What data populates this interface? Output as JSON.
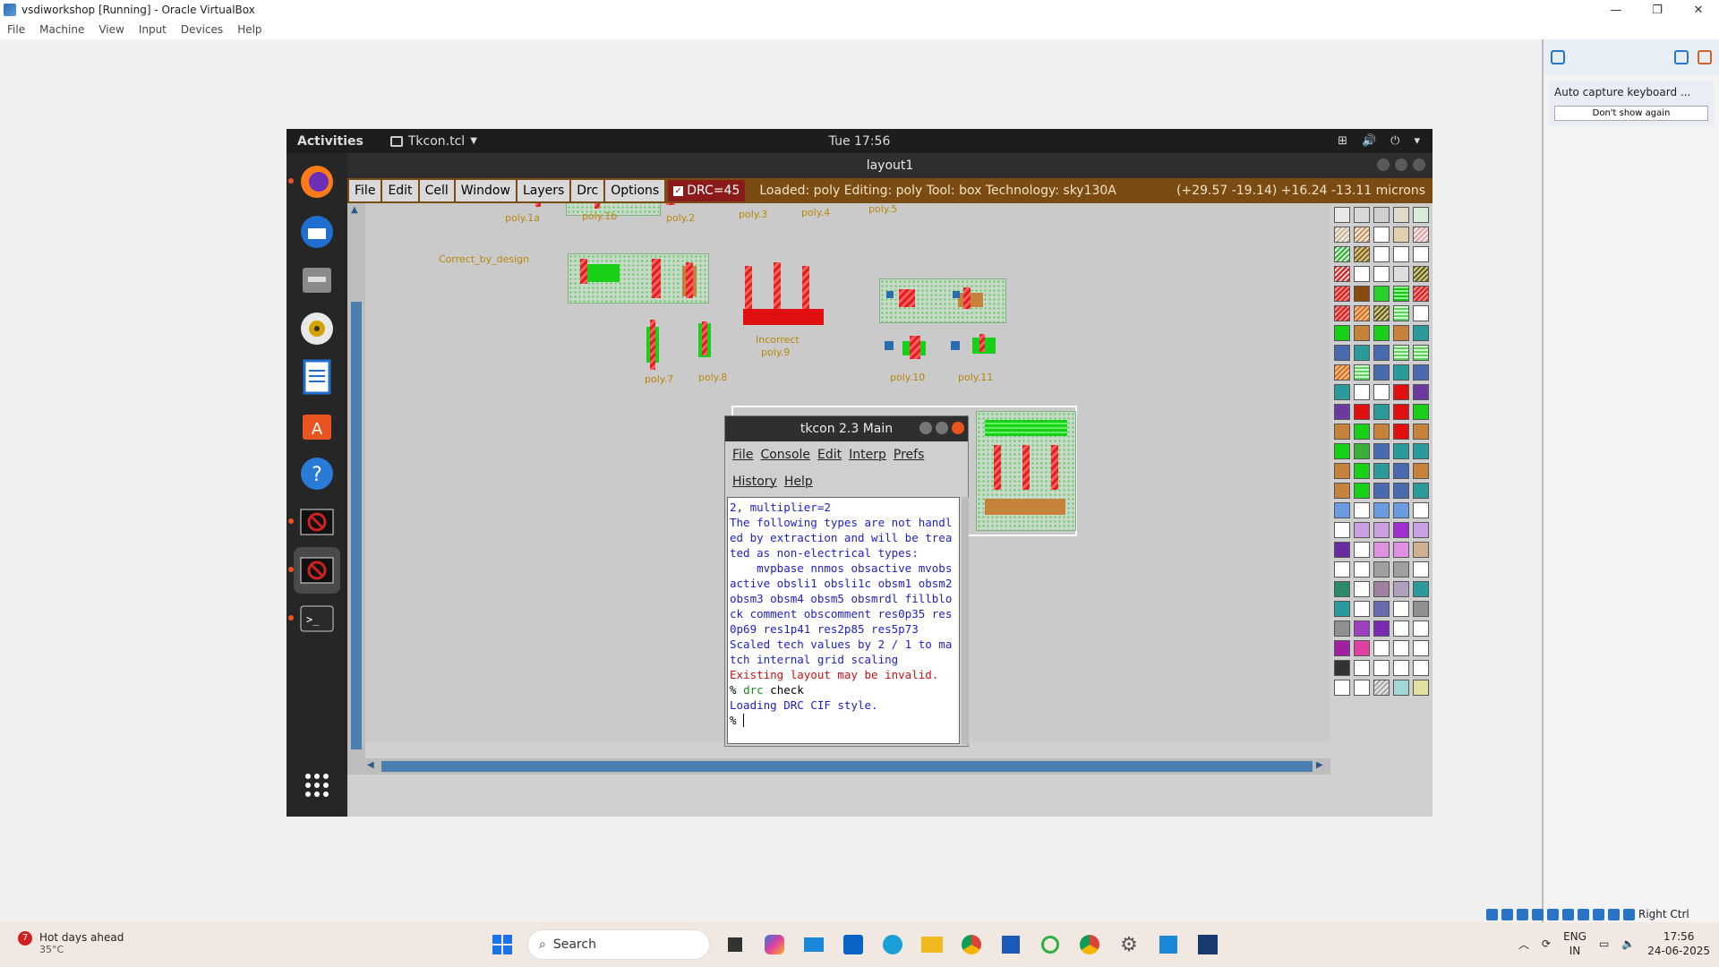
{
  "host": {
    "window_title": "vsdiworkshop [Running] - Oracle VirtualBox",
    "menu": [
      "File",
      "Machine",
      "View",
      "Input",
      "Devices",
      "Help"
    ],
    "panel_notice": "Auto capture keyboard ...",
    "panel_button": "Don't show again",
    "statusbar_key": "Right Ctrl"
  },
  "gnome": {
    "activities": "Activities",
    "app_menu": "Tkcon.tcl",
    "clock": "Tue 17:56"
  },
  "magic": {
    "title": "layout1",
    "menu": [
      "File",
      "Edit",
      "Cell",
      "Window",
      "Layers",
      "Drc",
      "Options"
    ],
    "drc_label": "DRC=45",
    "status": "Loaded: poly Editing: poly Tool: box  Technology: sky130A",
    "coords": "(+29.57 -19.14) +16.24 -13.11 microns",
    "canvas_labels": {
      "poly1a": "poly.1a",
      "poly1b": "poly.1b",
      "poly2": "poly.2",
      "poly3": "poly.3",
      "poly4": "poly.4",
      "poly5": "poly.5",
      "correct": "Correct_by_design",
      "poly7": "poly.7",
      "poly8": "poly.8",
      "incorrect": "Incorrect",
      "poly9": "poly.9",
      "poly10": "poly.10",
      "poly11": "poly.11"
    }
  },
  "tkcon": {
    "title": "tkcon 2.3 Main",
    "menu1": [
      "File",
      "Console",
      "Edit",
      "Interp",
      "Prefs"
    ],
    "menu2": [
      "History",
      "Help"
    ],
    "lines": {
      "l1": "2, multiplier=2\nThe following types are not handled by extraction and will be treated as non-electrical types:\n    mvpbase nnmos obsactive mvobsactive obsli1 obsli1c obsm1 obsm2 obsm3 obsm4 obsm5 obsmrdl fillblock comment obscomment res0p35 res0p69 res1p41 res2p85 res5p73\nScaled tech values by 2 / 1 to match internal grid scaling\n",
      "err": "Existing layout may be invalid.",
      "prompt1": "% ",
      "cmd1_a": "drc",
      "cmd1_b": " check",
      "l2": "Loading DRC CIF style.",
      "prompt2": "% "
    }
  },
  "taskbar": {
    "weather_badge": "7",
    "weather_title": "Hot days ahead",
    "weather_temp": "35°C",
    "search_placeholder": "Search",
    "lang_top": "ENG",
    "lang_bottom": "IN",
    "time": "17:56",
    "date": "24-06-2025"
  },
  "colors": {
    "magic_menu_bg": "#7a4b12",
    "drc_button_bg": "#8b1a1a",
    "poly_red": "#e02020",
    "diff_green": "#18d018",
    "tkcon_blue": "#1e1ec8",
    "tkcon_error": "#d01010"
  }
}
